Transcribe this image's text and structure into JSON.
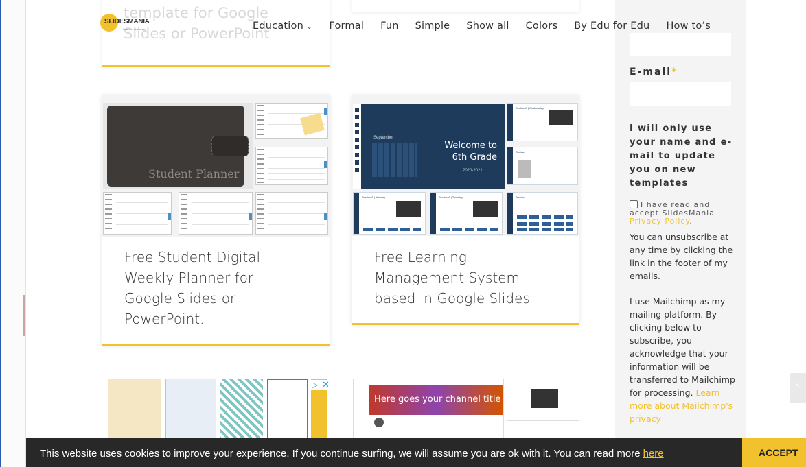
{
  "logo": {
    "text": "SLIDESMANIA",
    "sub": "teachers resources"
  },
  "nav": {
    "items": [
      {
        "label": "Education",
        "has_dropdown": true
      },
      {
        "label": "Formal"
      },
      {
        "label": "Fun"
      },
      {
        "label": "Simple"
      },
      {
        "label": "Show all"
      },
      {
        "label": "Colors"
      },
      {
        "label": "By Edu for Edu"
      },
      {
        "label": "How to’s"
      }
    ]
  },
  "partial_card": {
    "title_line1": "template for Google",
    "title_line2": "Slides or PowerPoint"
  },
  "cards": [
    {
      "title": "Free Student Digital Weekly Planner for Google Slides or PowerPoint.",
      "thumb_label": "Student Planner"
    },
    {
      "title": "Free Learning Management System based in Google Slides",
      "thumb_welcome": "Welcome to 6th Grade",
      "thumb_year": "2020-2021",
      "thumb_month": "September",
      "thumb_panels": [
        "Section A | Wednesday",
        "Contact",
        "Section A | Monday",
        "Section A | Tuesday",
        "Archive"
      ]
    }
  ],
  "lower_thumbs": {
    "channel_title": "Here goes your channel title"
  },
  "sidebar": {
    "email_label": "E-mail",
    "required_mark": "*",
    "info": "I will only use your name and e-mail to update you on new templates",
    "checkbox_label": "I have read and accept SlidesMania",
    "privacy_link": "Privacy Policy",
    "unsubscribe_text": "You can unsubscribe at any time by clicking the link in the footer of my emails.",
    "mailchimp_text": "I use Mailchimp as my mailing platform. By clicking below to subscribe, you acknowledge that your information will be transferred to Mailchimp for processing.",
    "mailchimp_link": "Learn more about Mailchimp's privacy"
  },
  "cookie": {
    "text": "This website uses cookies to improve your experience. If you continue surfing, we will assume you are ok with it. You can read more",
    "link": "here",
    "accept": "ACCEPT"
  },
  "colors": {
    "accent": "#f2c12e",
    "dark_bar": "#282828",
    "lms_blue": "#1f3b5c"
  }
}
